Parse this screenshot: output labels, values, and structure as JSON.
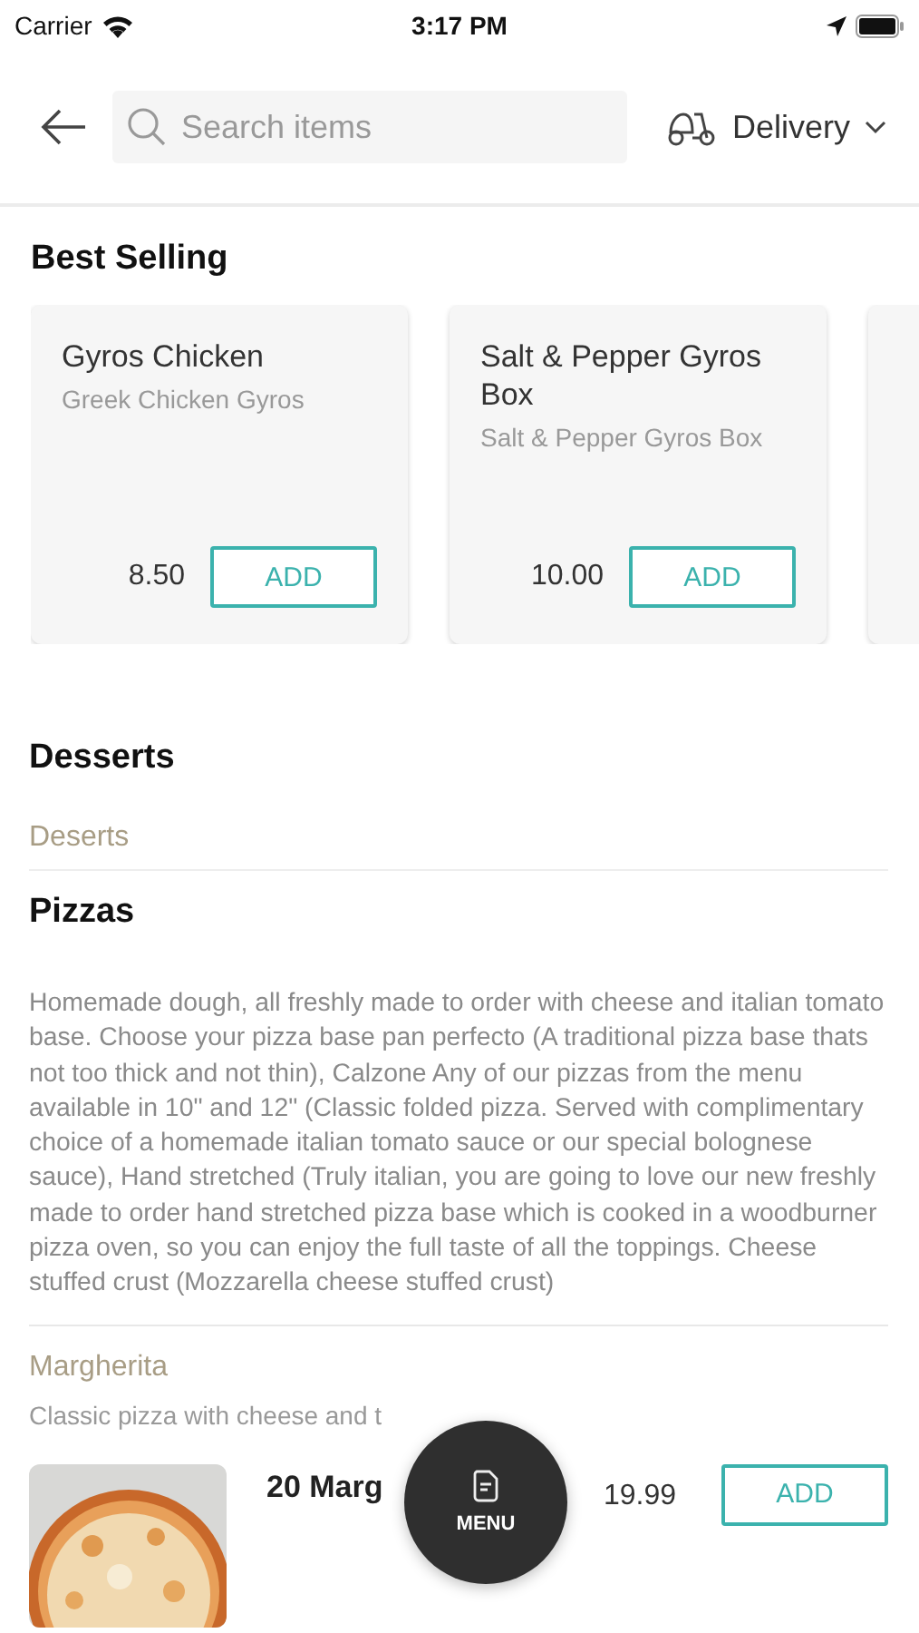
{
  "status_bar": {
    "carrier": "Carrier",
    "time": "3:17 PM"
  },
  "header": {
    "search": {
      "placeholder": "Search items"
    },
    "mode": {
      "label": "Delivery"
    }
  },
  "best_selling": {
    "title": "Best Selling",
    "cards": [
      {
        "kind": "item",
        "name": "Gyros Chicken",
        "description": "Greek Chicken Gyros",
        "price": "8.50",
        "button": "ADD"
      },
      {
        "kind": "item",
        "name": "Salt & Pepper Gyros Box",
        "description": "Salt & Pepper Gyros Box",
        "price": "10.00",
        "button": "ADD"
      },
      {
        "kind": "cut"
      }
    ]
  },
  "sections": [
    {
      "title": "Desserts",
      "subsections": [
        {
          "title": "Deserts"
        }
      ]
    },
    {
      "title": "Pizzas",
      "description": "Homemade dough, all freshly made to order with cheese and italian tomato base. Choose your pizza base pan perfecto (A traditional pizza base thats not too thick and not thin), Calzone Any of our pizzas from the menu available in 10\" and 12\" (Classic folded pizza. Served with complimentary choice of a homemade italian tomato sauce or our special bolognese sauce), Hand stretched (Truly italian, you are going to love our new freshly made to order hand stretched pizza base which is cooked in a woodburner pizza oven, so you can enjoy the full taste of all the toppings. Cheese stuffed crust (Mozzarella cheese stuffed crust)",
      "subsections": [
        {
          "title": "Margherita",
          "description": "Classic pizza with cheese and t",
          "items": [
            {
              "name": "20 Marg",
              "price": "19.99",
              "button": "ADD"
            }
          ]
        }
      ]
    }
  ],
  "fab": {
    "label": "MENU"
  }
}
